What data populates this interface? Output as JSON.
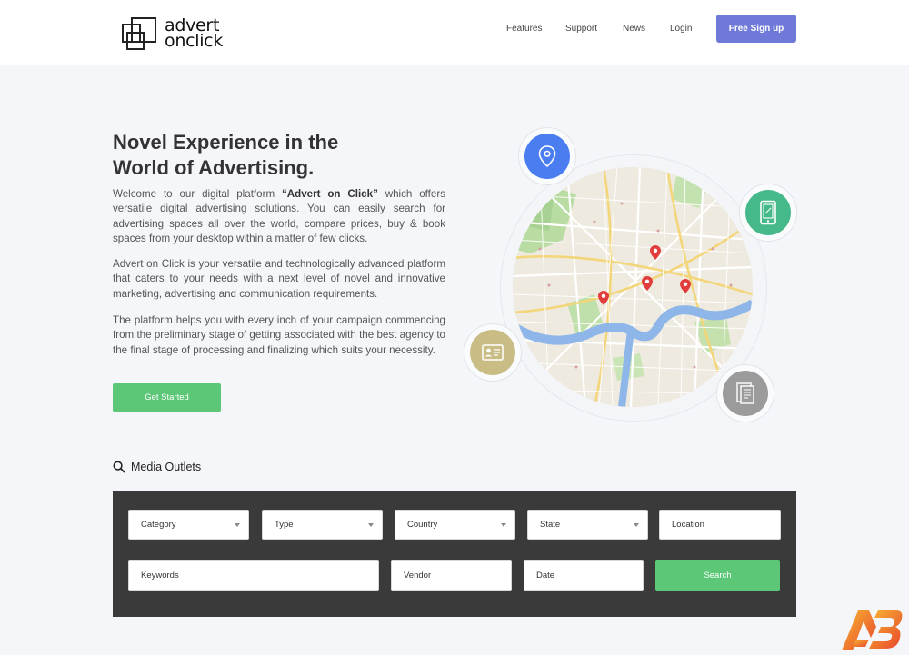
{
  "header": {
    "logo": {
      "line1": "advert",
      "line2": "onclick"
    },
    "nav": [
      {
        "label": "Features"
      },
      {
        "label": "Support"
      },
      {
        "label": "News"
      },
      {
        "label": "Login"
      }
    ],
    "signup_label": "Free Sign up"
  },
  "hero": {
    "title_line1": "Novel Experience in the",
    "title_line2": "World of Advertising.",
    "p1_pre": "Welcome to our digital platform ",
    "p1_bold": "“Advert on Click”",
    "p1_post": " which offers versatile digital advertising solutions. You can easily search for advertising spaces all over the world, compare prices, buy & book spaces from your desktop within a matter of few clicks.",
    "p2": "Advert on Click is your versatile and technologically advanced platform that caters to your needs with a next level of novel and innovative marketing, advertising and communication requirements.",
    "p3": "The platform helps you with every inch of your campaign commencing from the preliminary stage of getting associated with the best agency to the final stage of processing and finalizing which suits your necessity.",
    "cta_label": "Get Started"
  },
  "map": {
    "icons": [
      {
        "name": "location-pin-icon",
        "color": "#4a7ef0"
      },
      {
        "name": "mobile-icon",
        "color": "#46b98a"
      },
      {
        "name": "id-card-icon",
        "color": "#c9bd85"
      },
      {
        "name": "newspaper-icon",
        "color": "#9b9b9b"
      }
    ],
    "pin_color": "#e23d3d"
  },
  "search": {
    "label": "Media Outlets",
    "category": "Category",
    "type": "Type",
    "country": "Country",
    "state": "State",
    "location": "Location",
    "keywords": "Keywords",
    "vendor": "Vendor",
    "date": "Date",
    "button": "Search"
  },
  "colors": {
    "accent": "#6f79d8",
    "green": "#5cc877",
    "panel": "#3a3a3a"
  }
}
